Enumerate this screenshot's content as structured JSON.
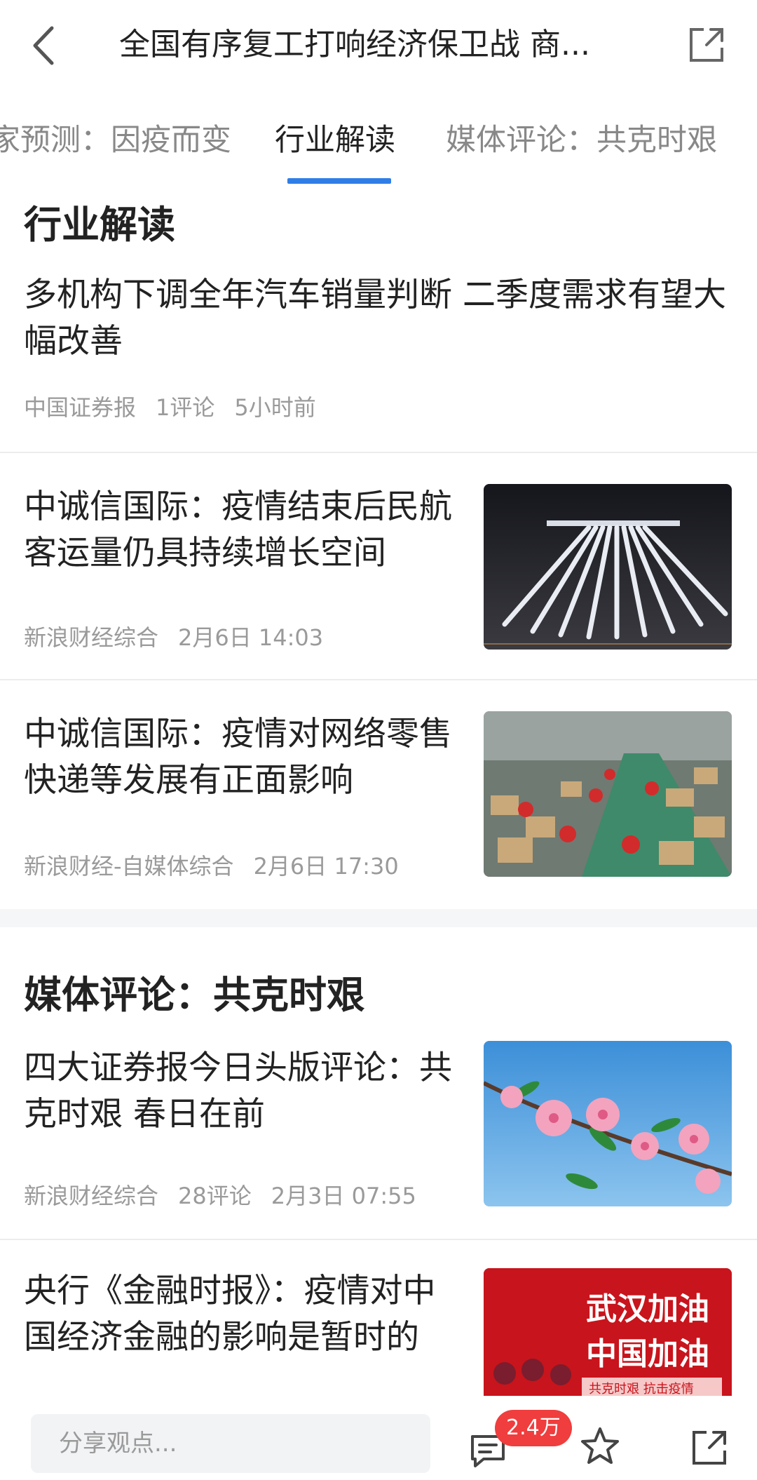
{
  "header": {
    "title": "全国有序复工打响经济保卫战 商...",
    "back_icon": "back-arrow-icon",
    "share_icon": "external-share-icon"
  },
  "tabs": [
    {
      "label": "家预测：因疫而变"
    },
    {
      "label": "行业解读",
      "active": true
    },
    {
      "label": "媒体评论：共克时艰"
    }
  ],
  "sections": [
    {
      "title": "行业解读",
      "articles": [
        {
          "headline": "多机构下调全年汽车销量判断 二季度需求有望大幅改善",
          "source": "中国证券报",
          "comments": "1评论",
          "time": "5小时前"
        },
        {
          "headline": "中诚信国际：疫情结束后民航客运量仍具持续增长空间",
          "source": "新浪财经综合",
          "time": "2月6日 14:03",
          "image": "high-speed-trains-night"
        },
        {
          "headline": "中诚信国际：疫情对网络零售快递等发展有正面影响",
          "source": "新浪财经-自媒体综合",
          "time": "2月6日 17:30",
          "image": "parcel-warehouse-workers"
        }
      ]
    },
    {
      "title": "媒体评论：共克时艰",
      "articles": [
        {
          "headline": "四大证券报今日头版评论：共克时艰 春日在前",
          "source": "新浪财经综合",
          "comments": "28评论",
          "time": "2月3日 07:55",
          "image": "peach-blossom"
        },
        {
          "headline": "央行《金融时报》：疫情对中国经济金融的影响是暂时的",
          "image": "wuhan-banner",
          "banner_line1": "武汉加油",
          "banner_line2": "中国加油",
          "banner_line3": "共克时艰 抗击疫情"
        }
      ]
    }
  ],
  "bottom_bar": {
    "input_placeholder": "分享观点...",
    "comment_count": "2.4万"
  },
  "colors": {
    "accent": "#2f7ee8",
    "badge": "#f03d3d",
    "meta_text": "#9a9a9a"
  }
}
